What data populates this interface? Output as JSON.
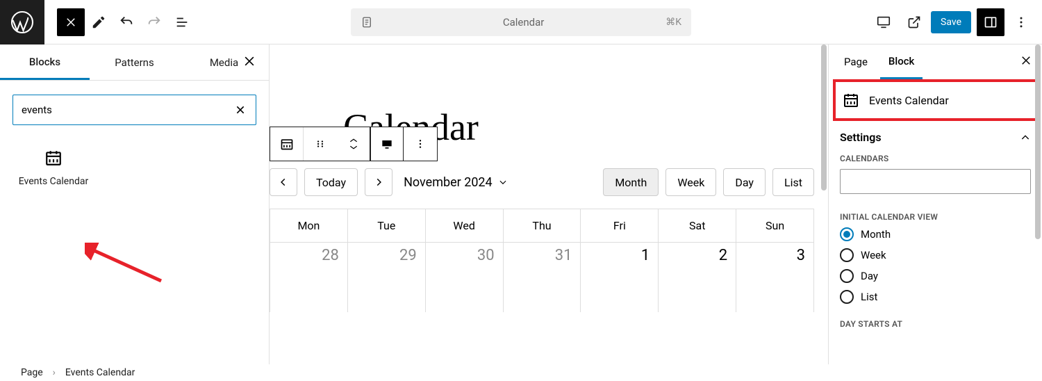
{
  "top": {
    "doc_title": "Calendar",
    "shortcut": "⌘K",
    "save": "Save"
  },
  "inserter": {
    "tabs": {
      "blocks": "Blocks",
      "patterns": "Patterns",
      "media": "Media"
    },
    "search_value": "events",
    "result_label": "Events Calendar"
  },
  "canvas": {
    "page_title": "Calendar",
    "today": "Today",
    "month_label": "November 2024",
    "views": {
      "month": "Month",
      "week": "Week",
      "day": "Day",
      "list": "List"
    },
    "weekdays": [
      "Mon",
      "Tue",
      "Wed",
      "Thu",
      "Fri",
      "Sat",
      "Sun"
    ],
    "row1": [
      {
        "d": "28",
        "dim": true
      },
      {
        "d": "29",
        "dim": true
      },
      {
        "d": "30",
        "dim": true
      },
      {
        "d": "31",
        "dim": true
      },
      {
        "d": "1",
        "dim": false
      },
      {
        "d": "2",
        "dim": false
      },
      {
        "d": "3",
        "dim": false
      }
    ]
  },
  "settings": {
    "tabs": {
      "page": "Page",
      "block": "Block"
    },
    "block_name": "Events Calendar",
    "settings_label": "Settings",
    "calendars_label": "CALENDARS",
    "initial_view_label": "INITIAL CALENDAR VIEW",
    "initial_views": [
      "Month",
      "Week",
      "Day",
      "List"
    ],
    "initial_view_selected": "Month",
    "day_starts_label": "DAY STARTS AT"
  },
  "breadcrumb": {
    "page": "Page",
    "block": "Events Calendar"
  }
}
